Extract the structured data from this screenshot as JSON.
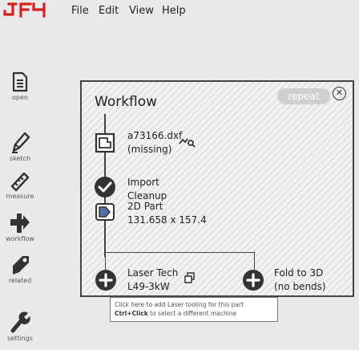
{
  "app": {
    "logo_text": "JFY"
  },
  "menu": [
    "File",
    "Edit",
    "View",
    "Help"
  ],
  "sidebar": {
    "items": [
      {
        "label": "open",
        "icon": "open-file-icon"
      },
      {
        "label": "sketch",
        "icon": "pencil-icon"
      },
      {
        "label": "measure",
        "icon": "ruler-icon"
      },
      {
        "label": "workflow",
        "icon": "workflow-arrow-icon"
      },
      {
        "label": "related",
        "icon": "tag-icon"
      },
      {
        "label": "settings",
        "icon": "wrench-icon"
      }
    ]
  },
  "workflow": {
    "title": "Workflow",
    "repeat_label": "repeat",
    "close_label": "✕",
    "steps": [
      {
        "line1": "a73166.dxf",
        "line2": "(missing)",
        "icon": "file-icon",
        "aside_icon": "link-icon"
      },
      {
        "line1": "Import",
        "line2": "Cleanup",
        "icon": "check-circle-icon"
      },
      {
        "line1": "2D Part",
        "line2": "131.658 x 157.4",
        "icon": "part-2d-icon"
      },
      {
        "line1": "Laser Tech",
        "line2": "L49-3kW",
        "icon": "add-circle-icon",
        "aside_icon": "copy-icon"
      },
      {
        "line1": "Fold to 3D",
        "line2": "(no bends)",
        "icon": "add-circle-icon"
      }
    ],
    "tooltip": {
      "line1": "Click here to add Laser tooling for this part",
      "line2_bold": "Ctrl+Click",
      "line2_rest": " to select a different machine"
    }
  },
  "colors": {
    "logo": "#d42020",
    "icon": "#333333",
    "panel_border": "#444444",
    "repeat_bg": "#cfcfcf"
  }
}
